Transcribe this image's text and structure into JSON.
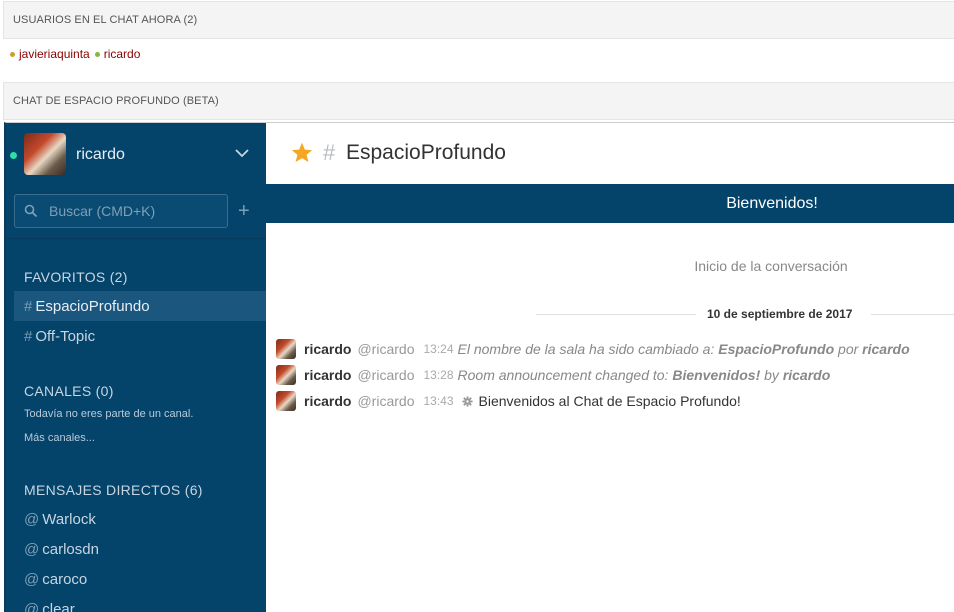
{
  "panels": {
    "users_heading": "USUARIOS EN EL CHAT AHORA (2)",
    "online_users": [
      {
        "name": "javieriaquinta",
        "dot_color": "#c9a227"
      },
      {
        "name": "ricardo",
        "dot_color": "#8db33c"
      }
    ],
    "chat_heading": "CHAT DE ESPACIO PROFUNDO (BETA)"
  },
  "sidebar": {
    "user": {
      "name": "ricardo",
      "status_color": "#2de0a5"
    },
    "search_placeholder": "Buscar (CMD+K)",
    "add_label": "+",
    "favorites": {
      "title": "FAVORITOS (2)",
      "items": [
        {
          "prefix": "#",
          "label": "EspacioProfundo",
          "active": true
        },
        {
          "prefix": "#",
          "label": "Off-Topic",
          "active": false
        }
      ]
    },
    "channels": {
      "title": "CANALES (0)",
      "empty_text": "Todavía no eres parte de un canal.",
      "more_link": "Más canales..."
    },
    "direct": {
      "title": "MENSAJES DIRECTOS (6)",
      "items": [
        {
          "prefix": "@",
          "label": "Warlock"
        },
        {
          "prefix": "@",
          "label": "carlosdn"
        },
        {
          "prefix": "@",
          "label": "caroco"
        },
        {
          "prefix": "@",
          "label": "clear"
        }
      ]
    }
  },
  "room": {
    "hash": "#",
    "name": "EspacioProfundo",
    "announcement": "Bienvenidos!",
    "conversation_start": "Inicio de la conversación",
    "date_separator": "10 de septiembre de 2017"
  },
  "messages": [
    {
      "user": "ricardo",
      "handle": "@ricardo",
      "time": "13:24",
      "type": "system",
      "parts": [
        "El nombre de la sala ha sido cambiado a: ",
        "EspacioProfundo",
        " por ",
        "ricardo"
      ]
    },
    {
      "user": "ricardo",
      "handle": "@ricardo",
      "time": "13:28",
      "type": "system",
      "parts": [
        "Room announcement changed to: ",
        "Bienvenidos!",
        " by ",
        "ricardo"
      ]
    },
    {
      "user": "ricardo",
      "handle": "@ricardo",
      "time": "13:43",
      "type": "text",
      "text": "Bienvenidos al Chat de Espacio Profundo!"
    }
  ],
  "colors": {
    "sidebar_bg": "#04436a",
    "sidebar_active": "#1a567d",
    "accent_star": "#f5a623",
    "online_user_text": "#8b0000"
  },
  "icons": {
    "star": "star-icon",
    "search": "search-icon",
    "chevron": "chevron-down-icon",
    "gear": "gear-icon"
  }
}
